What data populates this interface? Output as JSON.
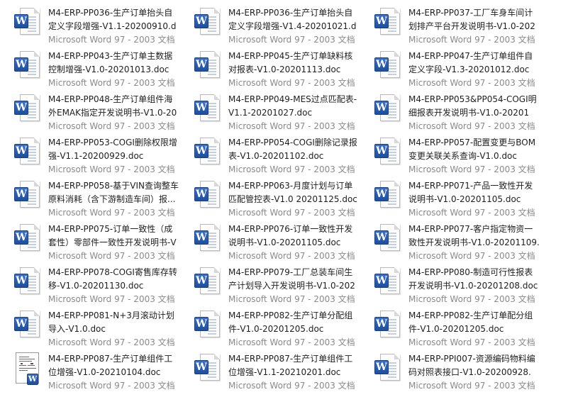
{
  "files": [
    {
      "name": "M4-ERP-PP036-生产订单抬头自定义字段增强-V1.1-20200910.doc",
      "type": "Microsoft Word 97 - 2003 文档",
      "icon": "word-doc-icon"
    },
    {
      "name": "M4-ERP-PP036-生产订单抬头自定义字段增强-V1.4-20201021.doc",
      "type": "Microsoft Word 97 - 2003 文档",
      "icon": "word-doc-icon"
    },
    {
      "name": "M4-ERP-PP037-工厂车身车间计划排产平台开发说明书-V1.0-20201...",
      "type": "Microsoft Word 97 - 2003 文档",
      "icon": "word-doc-icon"
    },
    {
      "name": "M4-ERP-PP043-生产订单主数据控制增强-V1.0-20201013.doc",
      "type": "Microsoft Word 97 - 2003 文档",
      "icon": "word-doc-icon"
    },
    {
      "name": "M4-ERP-PP045-生产订单缺料核对报表-V1.0-20201113.doc",
      "type": "Microsoft Word 97 - 2003 文档",
      "icon": "word-doc-icon"
    },
    {
      "name": "M4-ERP-PP047-生产订单组件自定义字段-V1.3-20201012.doc",
      "type": "Microsoft Word 97 - 2003 文档",
      "icon": "word-doc-icon"
    },
    {
      "name": "M4-ERP-PP048-生产订单组件海外EMAK指定开发说明书-V1.0-202...",
      "type": "Microsoft Word 97 - 2003 文档",
      "icon": "word-doc-icon"
    },
    {
      "name": "M4-ERP-PP049-MES过点匹配表-V1.1-20201027.doc",
      "type": "Microsoft Word 97 - 2003 文档",
      "icon": "word-doc-icon"
    },
    {
      "name": "M4-ERP-PP053&PP054-COGI明细报表开发说明书-V1.0-202012...",
      "type": "Microsoft Word 97 - 2003 文档",
      "icon": "word-doc-icon"
    },
    {
      "name": "M4-ERP-PP053-COGI删除权限增强-V1.1-20200929.doc",
      "type": "Microsoft Word 97 - 2003 文档",
      "icon": "word-doc-icon"
    },
    {
      "name": "M4-ERP-PP054-COGI删除记录报表-V1.0-20201102.doc",
      "type": "Microsoft Word 97 - 2003 文档",
      "icon": "word-doc-icon"
    },
    {
      "name": "M4-ERP-PP057-配置变更与BOM变更关联关系查询-V1.0.doc",
      "type": "Microsoft Word 97 - 2003 文档",
      "icon": "word-doc-icon"
    },
    {
      "name": "M4-ERP-PP058-基于VIN查询整车原料消耗（含下游制造车间）报...",
      "type": "Microsoft Word 97 - 2003 文档",
      "icon": "word-doc-icon"
    },
    {
      "name": "M4-ERP-PP063-月度计划与订单匹配管控表-V1.0 20201125.doc",
      "type": "Microsoft Word 97 - 2003 文档",
      "icon": "word-doc-icon"
    },
    {
      "name": "M4-ERP-PP071-产品一致性开发说明书-V1.0-20201105.doc",
      "type": "Microsoft Word 97 - 2003 文档",
      "icon": "word-doc-icon"
    },
    {
      "name": "M4-ERP-PP075-订单一致性（成套性）零部件一致性开发说明书-V1...",
      "type": "Microsoft Word 97 - 2003 文档",
      "icon": "word-doc-icon"
    },
    {
      "name": "M4-ERP-PP076-订单一致性开发说明书-V1.0-20201105.doc",
      "type": "Microsoft Word 97 - 2003 文档",
      "icon": "word-doc-icon"
    },
    {
      "name": "M4-ERP-PP077-客户指定物资一致性开发说明书-V1.0-20201109.d...",
      "type": "Microsoft Word 97 - 2003 文档",
      "icon": "word-doc-icon"
    },
    {
      "name": "M4-ERP-PP078-COGI寄售库存转移-V1.0-20201130.doc",
      "type": "Microsoft Word 97 - 2003 文档",
      "icon": "word-doc-icon"
    },
    {
      "name": "M4-ERP-PP079-工厂总装车间生产计划导入开发说明书-V1.0-20201...",
      "type": "Microsoft Word 97 - 2003 文档",
      "icon": "word-doc-icon"
    },
    {
      "name": "M4-ERP-PP080-制造可行性报表开发说明书-V1.0-20201208.doc",
      "type": "Microsoft Word 97 - 2003 文档",
      "icon": "word-doc-icon"
    },
    {
      "name": "M4-ERP-PP081-N+3月滚动计划导入-V1.0.doc",
      "type": "Microsoft Word 97 - 2003 文档",
      "icon": "word-doc-icon"
    },
    {
      "name": "M4-ERP-PP082-生产订单分配组件-V1.0-20201205.doc",
      "type": "Microsoft Word 97 - 2003 文档",
      "icon": "word-doc-icon"
    },
    {
      "name": "M4-ERP-PP082-生产订单配分组件-V1.0-20201205.doc",
      "type": "Microsoft Word 97 - 2003 文档",
      "icon": "word-doc-icon"
    },
    {
      "name": "M4-ERP-PP087-生产订单组件工位增强-V1.0-20210104.doc",
      "type": "Microsoft Word 97 - 2003 文档",
      "icon": "word-doc-thumbnail-icon"
    },
    {
      "name": "M4-ERP-PP087-生产订单组件工位增强-V1.1-20210201.doc",
      "type": "Microsoft Word 97 - 2003 文档",
      "icon": "word-doc-icon"
    },
    {
      "name": "M4-ERP-PPI007-资源编码物料编码对照表接口-V1.0-20200928.d...",
      "type": "Microsoft Word 97 - 2003 文档",
      "icon": "word-doc-icon"
    }
  ],
  "icon_glyph": "W",
  "colors": {
    "name_text": "#1e1e1e",
    "type_text": "#8a8a8a",
    "word_blue": "#2a5db0"
  }
}
